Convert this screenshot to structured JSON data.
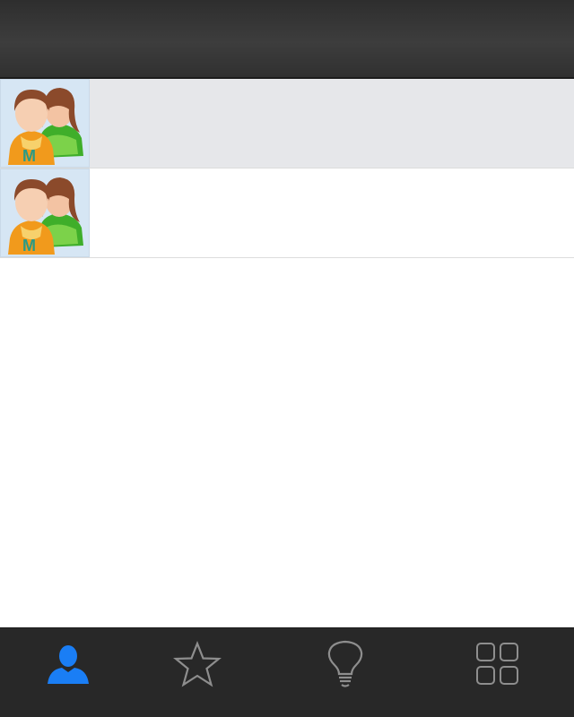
{
  "header": {
    "title": ""
  },
  "list": {
    "items": [
      {
        "avatar_icon": "group-avatar-icon",
        "label": "",
        "selected": true
      },
      {
        "avatar_icon": "group-avatar-icon",
        "label": "",
        "selected": false
      }
    ]
  },
  "tabbar": {
    "tabs": [
      {
        "icon": "person-icon",
        "active": true
      },
      {
        "icon": "star-icon",
        "active": false
      },
      {
        "icon": "lightbulb-icon",
        "active": false
      },
      {
        "icon": "grid-icon",
        "active": false
      }
    ]
  },
  "colors": {
    "header_bg": "#333333",
    "tabbar_bg": "#282828",
    "tab_active": "#1a7ef5",
    "tab_inactive": "#8e8e8e",
    "row_selected_bg": "#e6e7ea",
    "avatar_bg": "#d6e6f4"
  }
}
